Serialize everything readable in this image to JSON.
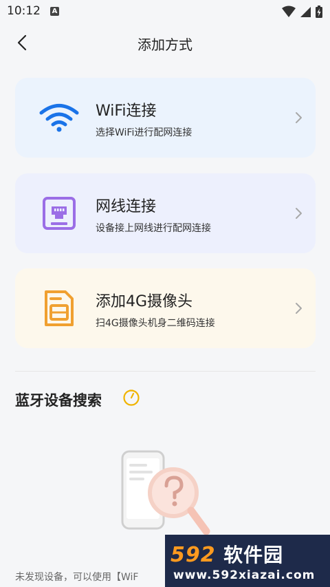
{
  "status_bar": {
    "time": "10:12",
    "notification_badge": "A"
  },
  "header": {
    "title": "添加方式"
  },
  "options": [
    {
      "title": "WiFi连接",
      "subtitle": "选择WiFi进行配网连接",
      "icon": "wifi-icon",
      "color": "#1a73e8"
    },
    {
      "title": "网线连接",
      "subtitle": "设备接上网线进行配网连接",
      "icon": "ethernet-port-icon",
      "color": "#9b6ee6"
    },
    {
      "title": "添加4G摄像头",
      "subtitle": "扫4G摄像头机身二维码连接",
      "icon": "sim-card-icon",
      "color": "#f0a030"
    }
  ],
  "bluetooth": {
    "title": "蓝牙设备搜索",
    "refresh_icon": "refresh-timer-icon"
  },
  "empty_state": {
    "text": "未发现设备，可以使用【WiF"
  },
  "watermark": {
    "brand_number": "592",
    "brand_name": "软件园",
    "url": "www.592xiazai.com"
  }
}
